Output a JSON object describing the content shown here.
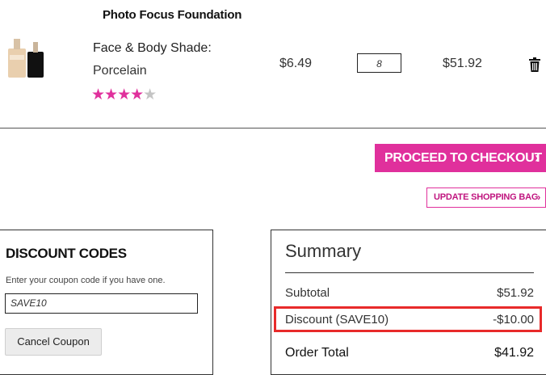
{
  "cart_item": {
    "product_name": "Photo Focus Foundation",
    "attribute_label": "Face & Body Shade:",
    "attribute_value": "Porcelain",
    "rating": 4,
    "rating_max": 5,
    "stars_filled": "★★★★",
    "stars_empty": "★",
    "unit_price": "$6.49",
    "quantity": "8",
    "row_total": "$51.92",
    "delete_icon": "trash-icon"
  },
  "actions": {
    "checkout_label": "PROCEED TO CHECKOUT",
    "checkout_chevron": "›",
    "update_label": "UPDATE SHOPPING BAG",
    "update_chevron": "›"
  },
  "discount": {
    "heading": "DISCOUNT CODES",
    "hint": "Enter your coupon code if you have one.",
    "coupon_value": "SAVE10",
    "cancel_label": "Cancel Coupon"
  },
  "summary": {
    "heading": "Summary",
    "rows": [
      {
        "label": "Subtotal",
        "value": "$51.92"
      },
      {
        "label": "Discount (SAVE10)",
        "value": "-$10.00"
      },
      {
        "label": "Order Total",
        "value": "$41.92"
      }
    ]
  },
  "colors": {
    "accent": "#e0309c",
    "highlight": "#e82a2a"
  }
}
